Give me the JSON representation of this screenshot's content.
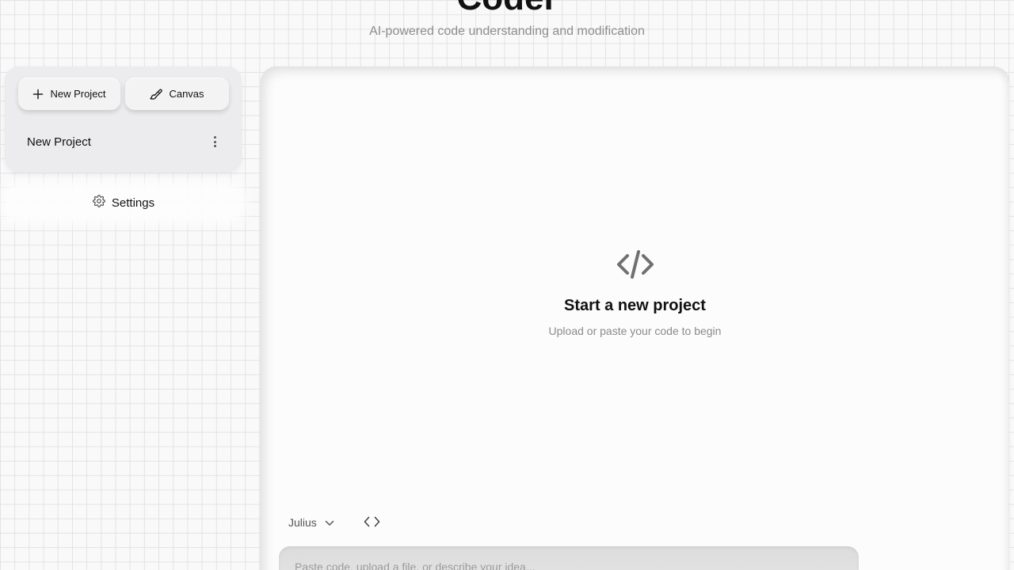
{
  "header": {
    "title": "Coder",
    "subtitle": "AI-powered code understanding and modification"
  },
  "sidebar": {
    "new_project_label": "New Project",
    "canvas_label": "Canvas",
    "projects": [
      {
        "name": "New Project"
      }
    ],
    "settings_label": "Settings"
  },
  "main": {
    "empty_icon": "code-icon",
    "empty_title": "Start a new project",
    "empty_description": "Upload or paste your code to begin",
    "model_selected": "Julius",
    "prompt_placeholder": "Paste code, upload a file, or describe your idea..."
  },
  "icons": {
    "new_project": "plus-icon",
    "canvas": "paintbrush-icon",
    "project_menu": "more-vertical-icon",
    "settings": "gear-icon",
    "model_dropdown": "chevron-down-icon",
    "code_toggle": "code-icon"
  }
}
